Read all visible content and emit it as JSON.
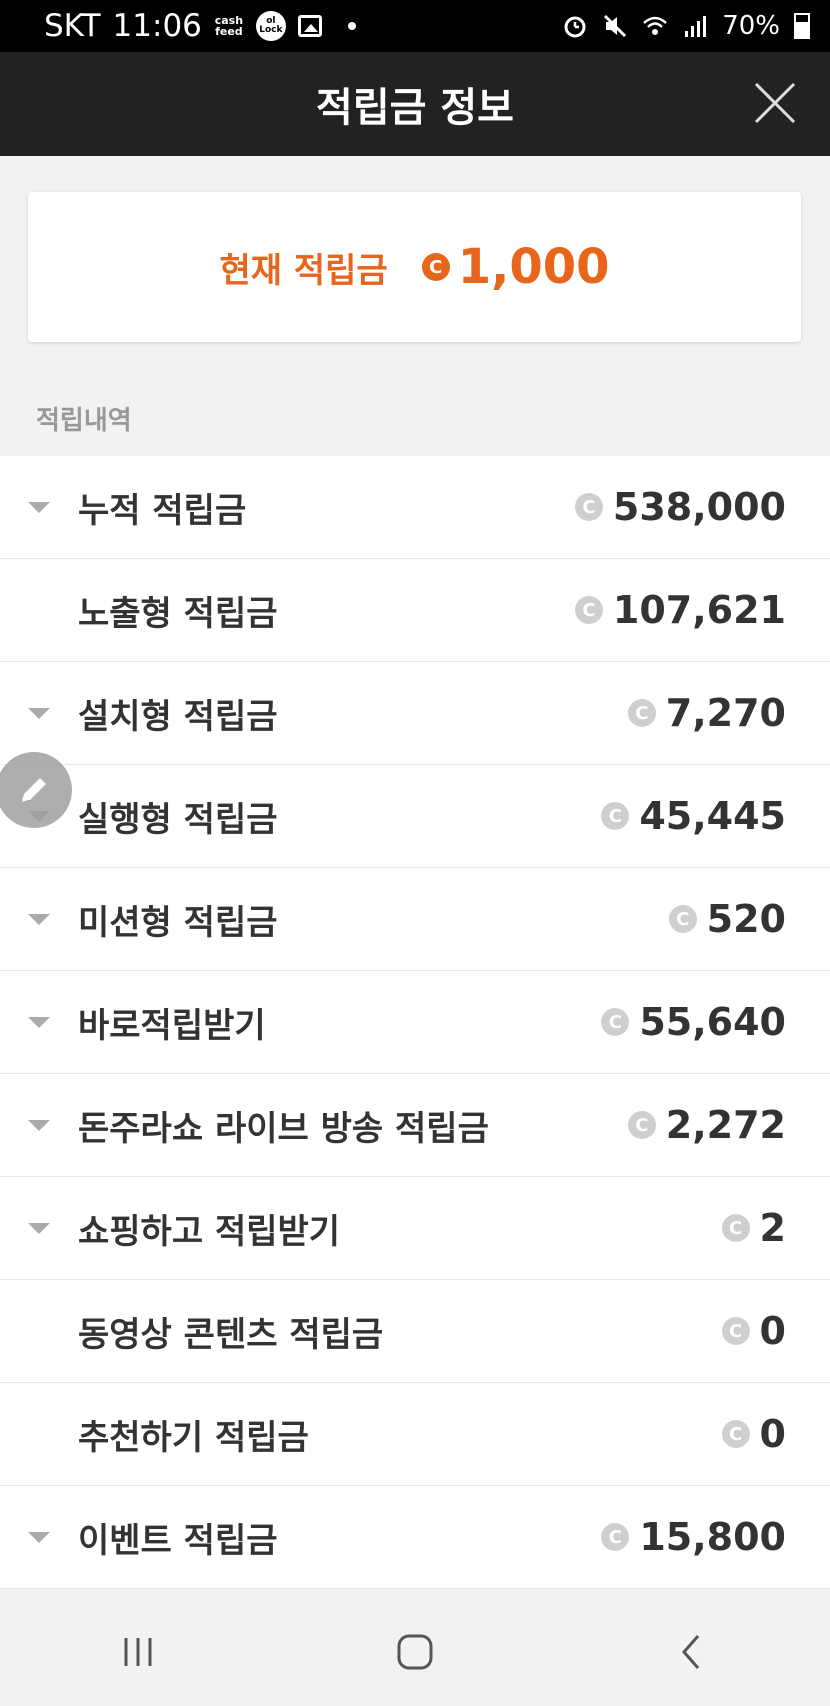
{
  "status_bar": {
    "carrier": "SKT",
    "time": "11:06",
    "cashfeed_icon_text": "cash feed",
    "lock_icon_text": "ol Lock",
    "battery": "70%"
  },
  "header": {
    "title": "적립금 정보",
    "close_icon": "close-icon"
  },
  "current": {
    "label": "현재 적립금",
    "coin_symbol": "C",
    "value": "1,000"
  },
  "section": {
    "title": "적립내역"
  },
  "items": [
    {
      "label": "누적 적립금",
      "value": "538,000",
      "expandable": true
    },
    {
      "label": "노출형 적립금",
      "value": "107,621",
      "expandable": false
    },
    {
      "label": "설치형 적립금",
      "value": "7,270",
      "expandable": true
    },
    {
      "label": "실행형 적립금",
      "value": "45,445",
      "expandable": true
    },
    {
      "label": "미션형 적립금",
      "value": "520",
      "expandable": true
    },
    {
      "label": "바로적립받기",
      "value": "55,640",
      "expandable": true
    },
    {
      "label": "돈주라쇼 라이브 방송 적립금",
      "value": "2,272",
      "expandable": true
    },
    {
      "label": "쇼핑하고 적립받기",
      "value": "2",
      "expandable": true
    },
    {
      "label": "동영상 콘텐츠 적립금",
      "value": "0",
      "expandable": false
    },
    {
      "label": "추천하기 적립금",
      "value": "0",
      "expandable": false
    },
    {
      "label": "이벤트 적립금",
      "value": "15,800",
      "expandable": true
    }
  ],
  "colors": {
    "accent": "#e8651c",
    "header_bg": "#222222",
    "coin_grey": "#cfcfcf"
  }
}
